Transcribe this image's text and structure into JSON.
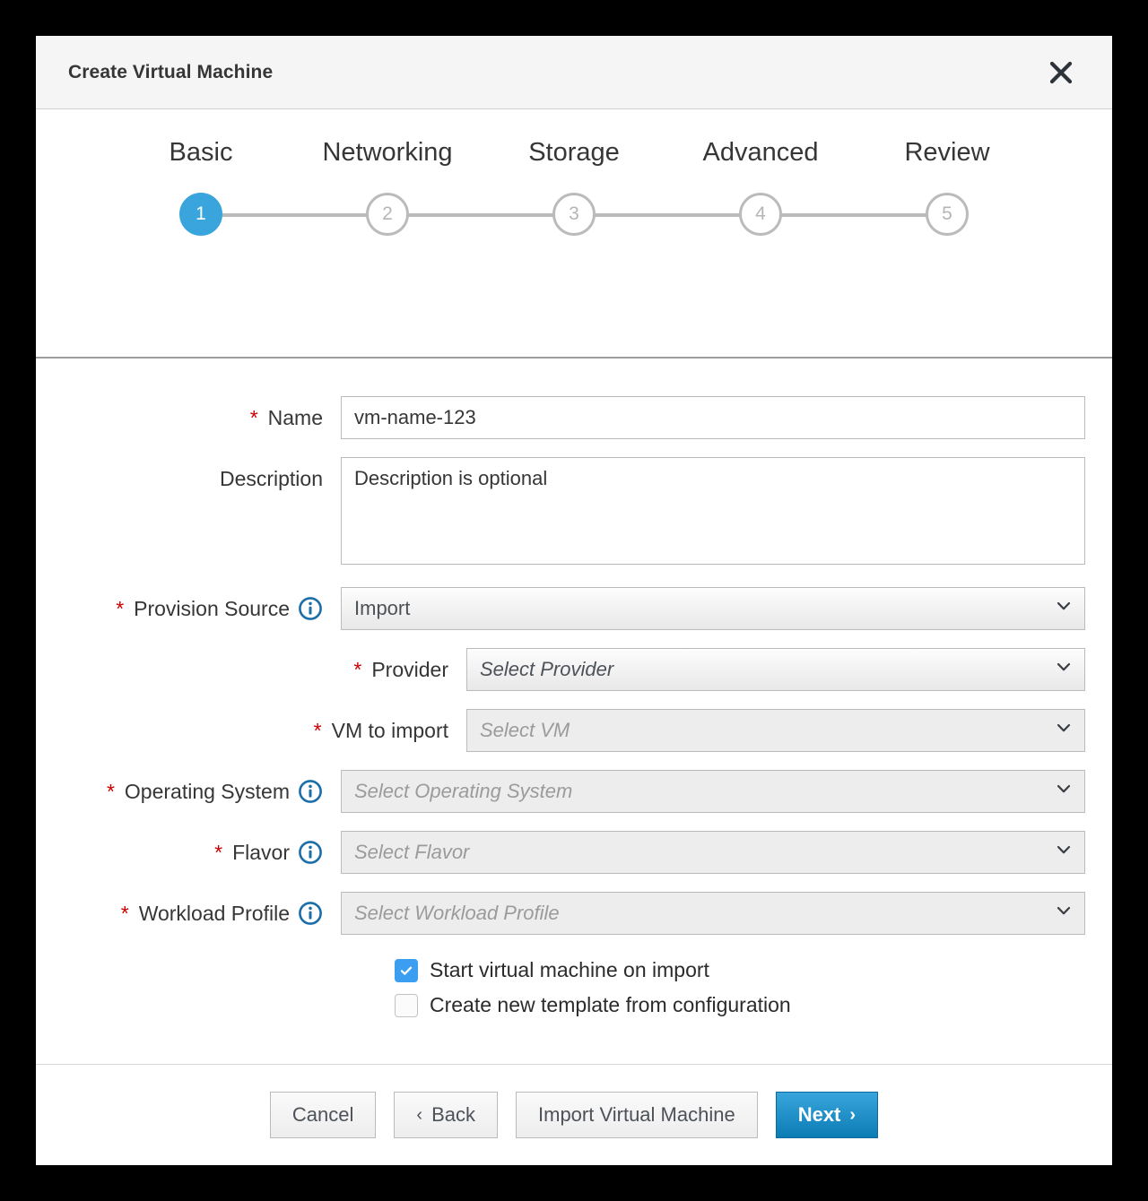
{
  "window": {
    "title": "Create Virtual Machine",
    "close_icon": "close-icon"
  },
  "wizard": {
    "steps": [
      {
        "label": "Basic",
        "number": "1",
        "active": true
      },
      {
        "label": "Networking",
        "number": "2",
        "active": false
      },
      {
        "label": "Storage",
        "number": "3",
        "active": false
      },
      {
        "label": "Advanced",
        "number": "4",
        "active": false
      },
      {
        "label": "Review",
        "number": "5",
        "active": false
      }
    ],
    "active_step": 1,
    "active_color": "#39a5dc",
    "inactive_color": "#bbbbbb"
  },
  "form": {
    "required_marker": "*",
    "name": {
      "label": "Name",
      "value": "vm-name-123",
      "required": true
    },
    "description": {
      "label": "Description",
      "value": "Description is optional",
      "required": false
    },
    "provision_source": {
      "label": "Provision Source",
      "value": "Import",
      "required": true,
      "has_info": true,
      "disabled": false,
      "italic": false
    },
    "provider": {
      "label": "Provider",
      "value": "Select Provider",
      "required": true,
      "has_info": false,
      "disabled": false,
      "italic": true
    },
    "vm_to_import": {
      "label": "VM to import",
      "value": "Select VM",
      "required": true,
      "has_info": false,
      "disabled": true,
      "italic": true
    },
    "operating_system": {
      "label": "Operating System",
      "value": "Select Operating System",
      "required": true,
      "has_info": true,
      "disabled": true,
      "italic": true
    },
    "flavor": {
      "label": "Flavor",
      "value": "Select Flavor",
      "required": true,
      "has_info": true,
      "disabled": true,
      "italic": true
    },
    "workload_profile": {
      "label": "Workload Profile",
      "value": "Select Workload Profile",
      "required": true,
      "has_info": true,
      "disabled": true,
      "italic": true
    },
    "checkboxes": [
      {
        "label": "Start virtual machine on import",
        "checked": true
      },
      {
        "label": "Create new template from configuration",
        "checked": false
      }
    ]
  },
  "footer": {
    "cancel_label": "Cancel",
    "back_label": "Back",
    "back_caret": "‹",
    "import_label": "Import Virtual Machine",
    "next_label": "Next",
    "next_caret": "›"
  },
  "colors": {
    "accent_blue": "#39a5dc",
    "primary_blue_dark": "#0c7cb5",
    "required_red": "#cc0000",
    "checkbox_blue": "#3b9ef0",
    "info_blue": "#1b6ea8"
  }
}
